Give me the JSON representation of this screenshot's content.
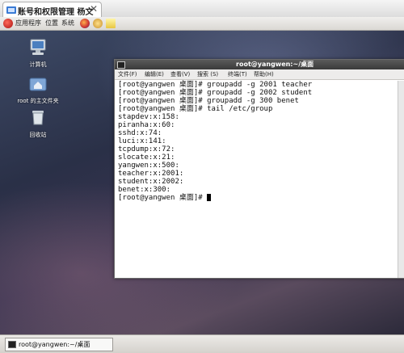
{
  "tab": {
    "title": "账号和权限管理 杨文",
    "close_glyph": "✕"
  },
  "panel": {
    "menus": [
      "应用程序",
      "位置",
      "系统"
    ]
  },
  "desktop": {
    "icons": [
      {
        "label": "计算机",
        "icon": "computer-icon"
      },
      {
        "label": "root 的主文件夹",
        "icon": "home-folder-icon"
      },
      {
        "label": "回收站",
        "icon": "trash-icon"
      }
    ]
  },
  "terminal": {
    "title": "root@yangwen:~/桌面",
    "menus": [
      "文件(F)",
      "编辑(E)",
      "查看(V)",
      "搜索 (S)",
      "终端(T)",
      "帮助(H)"
    ],
    "lines": [
      "[root@yangwen 桌面]# groupadd -g 2001 teacher",
      "[root@yangwen 桌面]# groupadd -g 2002 student",
      "[root@yangwen 桌面]# groupadd -g 300 benet",
      "[root@yangwen 桌面]# tail /etc/group",
      "stapdev:x:158:",
      "piranha:x:60:",
      "sshd:x:74:",
      "luci:x:141:",
      "tcpdump:x:72:",
      "slocate:x:21:",
      "yangwen:x:500:",
      "teacher:x:2001:",
      "student:x:2002:",
      "benet:x:300:",
      "[root@yangwen 桌面]# "
    ]
  },
  "taskbar": {
    "window_label": "root@yangwen:~/桌面"
  }
}
